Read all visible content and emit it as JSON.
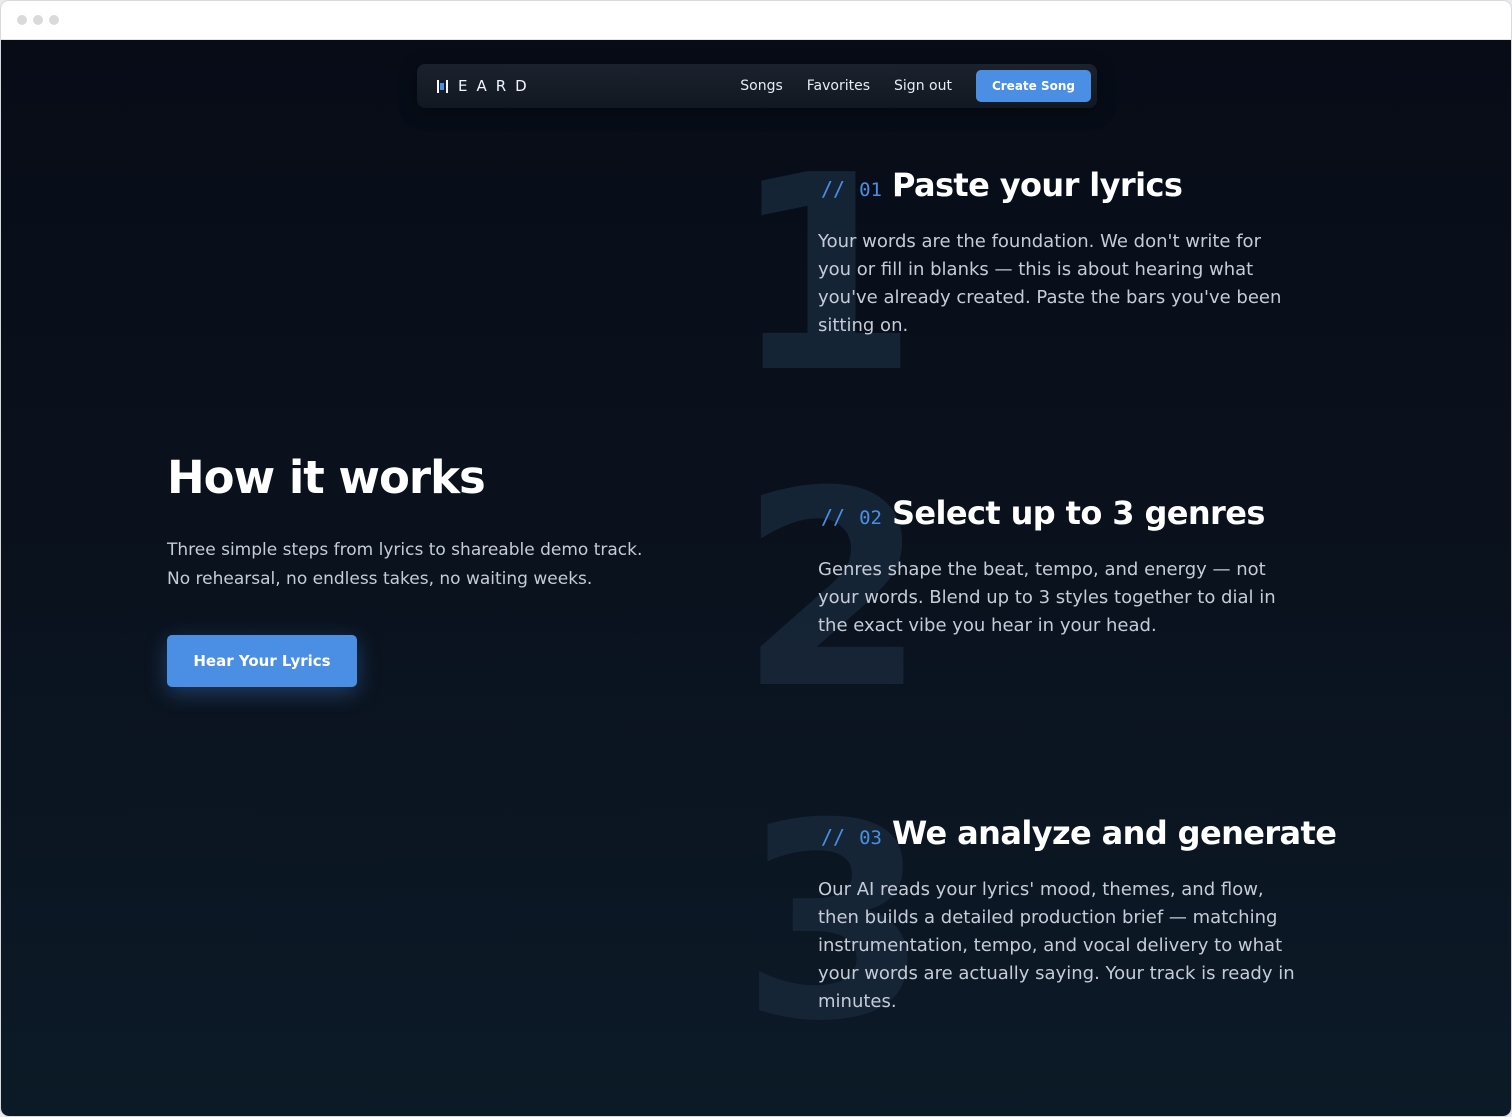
{
  "nav": {
    "logo_text": "EARD",
    "links": [
      "Songs",
      "Favorites",
      "Sign out"
    ],
    "cta_label": "Create Song"
  },
  "intro": {
    "title": "How it works",
    "description": "Three simple steps from lyrics to shareable demo track. No rehearsal, no endless takes, no waiting weeks.",
    "button_label": "Hear Your Lyrics"
  },
  "steps": [
    {
      "big_number": "1",
      "slash": "//",
      "number": "01",
      "title": "Paste your lyrics",
      "description": "Your words are the foundation. We don't write for you or fill in blanks — this is about hearing what you've already created. Paste the bars you've been sitting on."
    },
    {
      "big_number": "2",
      "slash": "//",
      "number": "02",
      "title": "Select up to 3 genres",
      "description": "Genres shape the beat, tempo, and energy — not your words. Blend up to 3 styles together to dial in the exact vibe you hear in your head."
    },
    {
      "big_number": "3",
      "slash": "//",
      "number": "03",
      "title": "We analyze and generate",
      "description": "Our AI reads your lyrics' mood, themes, and flow, then builds a detailed production brief — matching instrumentation, tempo, and vocal delivery to what your words are actually saying. Your track is ready in minutes."
    }
  ],
  "colors": {
    "accent": "#4a8fe3",
    "background_top": "#070c17",
    "background_bottom": "#0c1a27",
    "big_number": "#18283a"
  }
}
